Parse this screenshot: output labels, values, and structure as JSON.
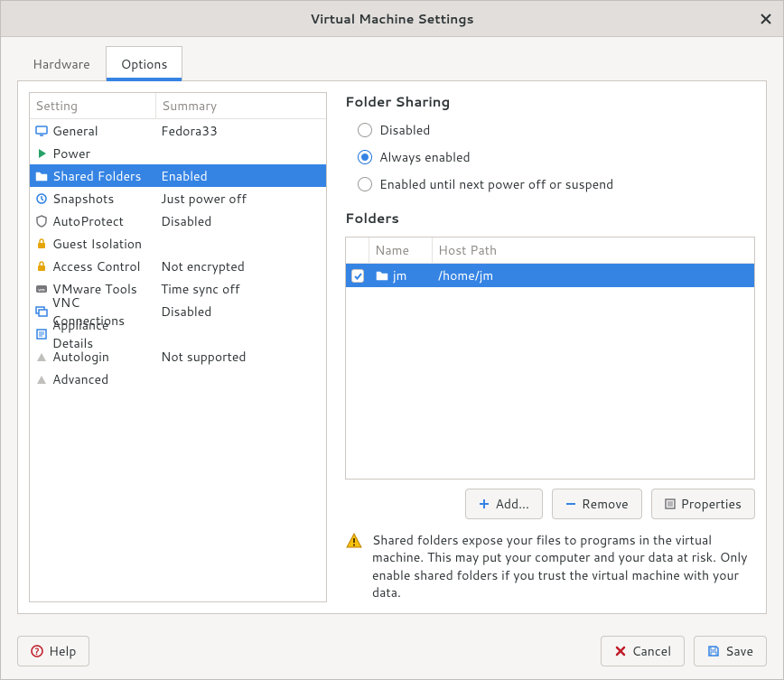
{
  "window": {
    "title": "Virtual Machine Settings"
  },
  "tabs": {
    "hardware": "Hardware",
    "options": "Options"
  },
  "settings_header": {
    "setting": "Setting",
    "summary": "Summary"
  },
  "settings": [
    {
      "icon": "monitor-icon",
      "label": "General",
      "summary": "Fedora33",
      "color": "#3584e4"
    },
    {
      "icon": "play-icon",
      "label": "Power",
      "summary": "",
      "color": "#26a269"
    },
    {
      "icon": "folder-icon",
      "label": "Shared Folders",
      "summary": "Enabled",
      "selected": true,
      "color": "#c8b273"
    },
    {
      "icon": "snapshot-icon",
      "label": "Snapshots",
      "summary": "Just power off",
      "color": "#3584e4"
    },
    {
      "icon": "shield-icon",
      "label": "AutoProtect",
      "summary": "Disabled",
      "color": "#77767b"
    },
    {
      "icon": "lock-icon",
      "label": "Guest Isolation",
      "summary": "",
      "color": "#e5a50a"
    },
    {
      "icon": "lock-icon",
      "label": "Access Control",
      "summary": "Not encrypted",
      "color": "#e5a50a"
    },
    {
      "icon": "tools-icon",
      "label": "VMware Tools",
      "summary": "Time sync off",
      "color": "#77767b"
    },
    {
      "icon": "vnc-icon",
      "label": "VNC Connections",
      "summary": "Disabled",
      "color": "#3584e4"
    },
    {
      "icon": "appliance-icon",
      "label": "Appliance Details",
      "summary": "",
      "color": "#3584e4"
    },
    {
      "icon": "blank-icon",
      "label": "Autologin",
      "summary": "Not supported",
      "color": "#c0bfbc"
    },
    {
      "icon": "blank-icon",
      "label": "Advanced",
      "summary": "",
      "color": "#c0bfbc"
    }
  ],
  "folder_sharing": {
    "title": "Folder Sharing",
    "options": {
      "disabled": "Disabled",
      "always": "Always enabled",
      "until_off": "Enabled until next power off or suspend"
    },
    "selected": "always"
  },
  "folders": {
    "title": "Folders",
    "header": {
      "name": "Name",
      "path": "Host Path"
    },
    "rows": [
      {
        "checked": true,
        "name": "jm",
        "path": "/home/jm"
      }
    ]
  },
  "folder_buttons": {
    "add": "Add...",
    "remove": "Remove",
    "properties": "Properties"
  },
  "warning": "Shared folders expose your files to programs in the virtual machine. This may put your computer and your data at risk. Only enable shared folders if you trust the virtual machine with your data.",
  "footer": {
    "help": "Help",
    "cancel": "Cancel",
    "save": "Save"
  }
}
